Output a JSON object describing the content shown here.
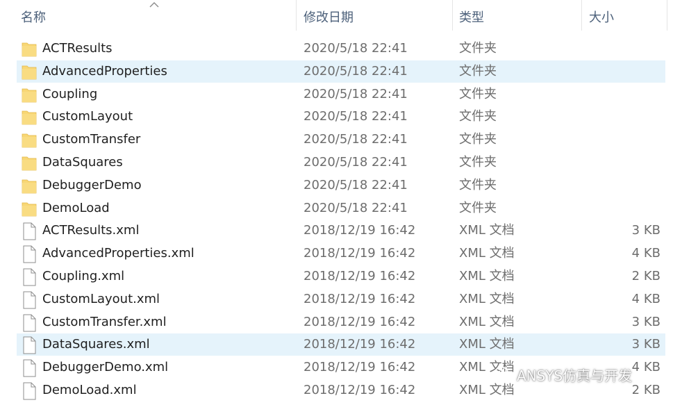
{
  "columns": {
    "name": "名称",
    "date": "修改日期",
    "type": "类型",
    "size": "大小"
  },
  "files": [
    {
      "name": "ACTResults",
      "date": "2020/5/18 22:41",
      "type": "文件夹",
      "size": "",
      "icon": "folder-icon"
    },
    {
      "name": "AdvancedProperties",
      "date": "2020/5/18 22:41",
      "type": "文件夹",
      "size": "",
      "icon": "folder-icon"
    },
    {
      "name": "Coupling",
      "date": "2020/5/18 22:41",
      "type": "文件夹",
      "size": "",
      "icon": "folder-icon"
    },
    {
      "name": "CustomLayout",
      "date": "2020/5/18 22:41",
      "type": "文件夹",
      "size": "",
      "icon": "folder-icon"
    },
    {
      "name": "CustomTransfer",
      "date": "2020/5/18 22:41",
      "type": "文件夹",
      "size": "",
      "icon": "folder-icon"
    },
    {
      "name": "DataSquares",
      "date": "2020/5/18 22:41",
      "type": "文件夹",
      "size": "",
      "icon": "folder-icon"
    },
    {
      "name": "DebuggerDemo",
      "date": "2020/5/18 22:41",
      "type": "文件夹",
      "size": "",
      "icon": "folder-icon"
    },
    {
      "name": "DemoLoad",
      "date": "2020/5/18 22:41",
      "type": "文件夹",
      "size": "",
      "icon": "folder-icon"
    },
    {
      "name": "ACTResults.xml",
      "date": "2018/12/19 16:42",
      "type": "XML 文档",
      "size": "3 KB",
      "icon": "file-icon"
    },
    {
      "name": "AdvancedProperties.xml",
      "date": "2018/12/19 16:42",
      "type": "XML 文档",
      "size": "4 KB",
      "icon": "file-icon"
    },
    {
      "name": "Coupling.xml",
      "date": "2018/12/19 16:42",
      "type": "XML 文档",
      "size": "2 KB",
      "icon": "file-icon"
    },
    {
      "name": "CustomLayout.xml",
      "date": "2018/12/19 16:42",
      "type": "XML 文档",
      "size": "4 KB",
      "icon": "file-icon"
    },
    {
      "name": "CustomTransfer.xml",
      "date": "2018/12/19 16:42",
      "type": "XML 文档",
      "size": "3 KB",
      "icon": "file-icon"
    },
    {
      "name": "DataSquares.xml",
      "date": "2018/12/19 16:42",
      "type": "XML 文档",
      "size": "3 KB",
      "icon": "file-icon"
    },
    {
      "name": "DebuggerDemo.xml",
      "date": "2018/12/19 16:42",
      "type": "XML 文档",
      "size": "4 KB",
      "icon": "file-icon"
    },
    {
      "name": "DemoLoad.xml",
      "date": "2018/12/19 16:42",
      "type": "XML 文档",
      "size": "2 KB",
      "icon": "file-icon"
    }
  ],
  "selected_rows": [
    1,
    13
  ],
  "watermark": {
    "text": "ANSYS仿真与开发",
    "icon": "wechat-icon"
  },
  "colors": {
    "header_text": "#4c607a",
    "selection_bg": "#e5f3fb",
    "folder": "#f8d775",
    "secondary_text": "#6d6d6d"
  },
  "sort": {
    "column": "name",
    "direction": "ascending",
    "icon": "sort-up-icon"
  }
}
